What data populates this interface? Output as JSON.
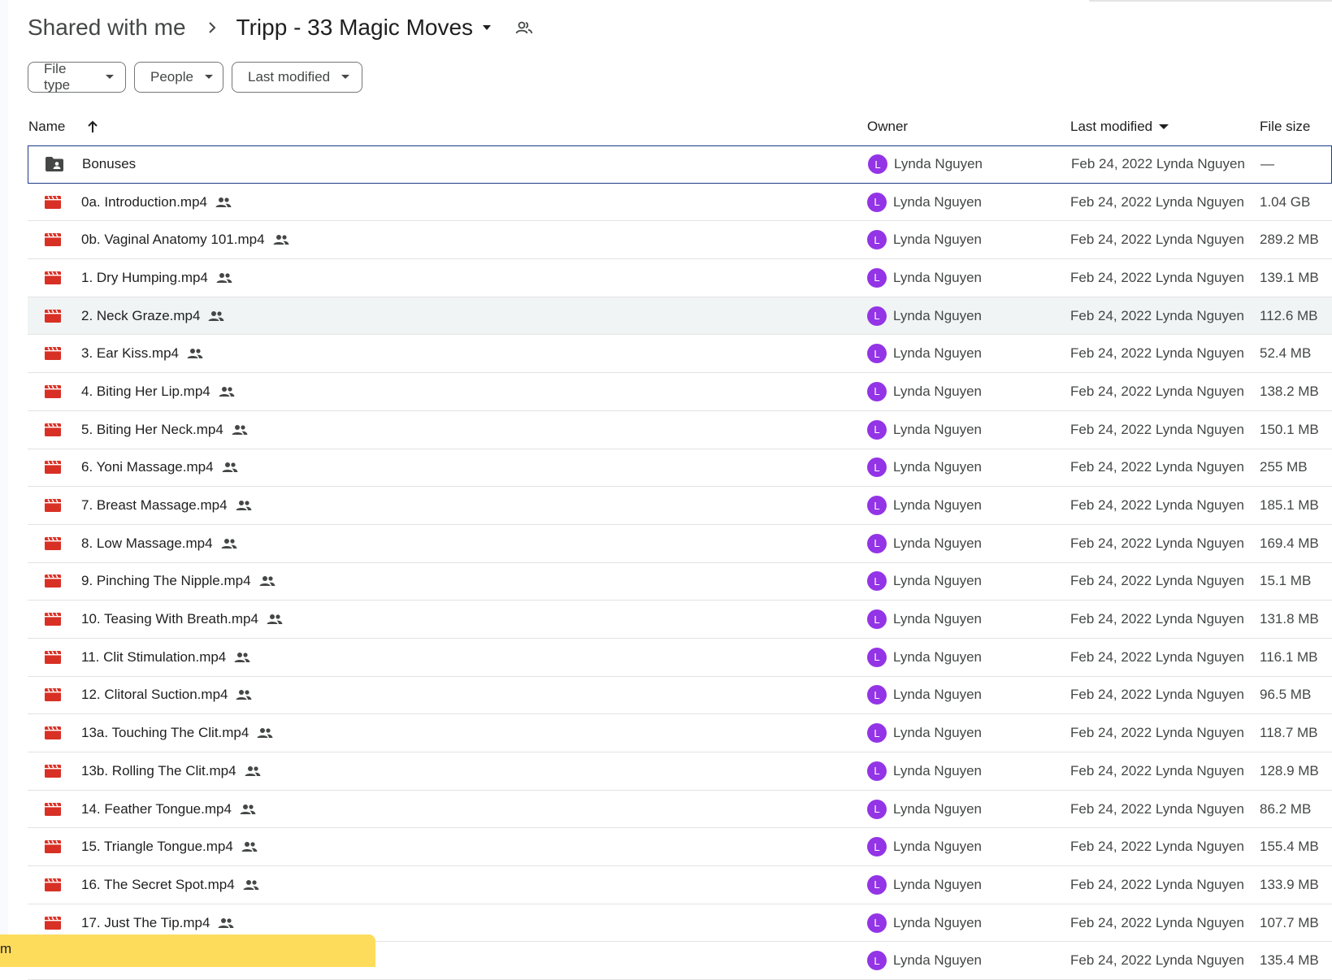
{
  "breadcrumb": {
    "root": "Shared with me",
    "current": "Tripp - 33 Magic Moves"
  },
  "filters": [
    {
      "label": "File type"
    },
    {
      "label": "People"
    },
    {
      "label": "Last modified"
    }
  ],
  "columns": {
    "name": "Name",
    "owner": "Owner",
    "last_modified": "Last modified",
    "file_size": "File size"
  },
  "rows": [
    {
      "name": "Bonuses",
      "type": "folder",
      "shared": false,
      "owner": "Lynda Nguyen",
      "owner_initial": "L",
      "modified": "Feb 24, 2022 Lynda Nguyen",
      "size": "—"
    },
    {
      "name": "0a. Introduction.mp4",
      "type": "video",
      "shared": true,
      "owner": "Lynda Nguyen",
      "owner_initial": "L",
      "modified": "Feb 24, 2022 Lynda Nguyen",
      "size": "1.04 GB"
    },
    {
      "name": "0b. Vaginal Anatomy 101.mp4",
      "type": "video",
      "shared": true,
      "owner": "Lynda Nguyen",
      "owner_initial": "L",
      "modified": "Feb 24, 2022 Lynda Nguyen",
      "size": "289.2 MB"
    },
    {
      "name": "1. Dry Humping.mp4",
      "type": "video",
      "shared": true,
      "owner": "Lynda Nguyen",
      "owner_initial": "L",
      "modified": "Feb 24, 2022 Lynda Nguyen",
      "size": "139.1 MB"
    },
    {
      "name": "2. Neck Graze.mp4",
      "type": "video",
      "shared": true,
      "owner": "Lynda Nguyen",
      "owner_initial": "L",
      "modified": "Feb 24, 2022 Lynda Nguyen",
      "size": "112.6 MB"
    },
    {
      "name": "3. Ear Kiss.mp4",
      "type": "video",
      "shared": true,
      "owner": "Lynda Nguyen",
      "owner_initial": "L",
      "modified": "Feb 24, 2022 Lynda Nguyen",
      "size": "52.4 MB"
    },
    {
      "name": "4. Biting Her Lip.mp4",
      "type": "video",
      "shared": true,
      "owner": "Lynda Nguyen",
      "owner_initial": "L",
      "modified": "Feb 24, 2022 Lynda Nguyen",
      "size": "138.2 MB"
    },
    {
      "name": "5. Biting Her Neck.mp4",
      "type": "video",
      "shared": true,
      "owner": "Lynda Nguyen",
      "owner_initial": "L",
      "modified": "Feb 24, 2022 Lynda Nguyen",
      "size": "150.1 MB"
    },
    {
      "name": "6. Yoni Massage.mp4",
      "type": "video",
      "shared": true,
      "owner": "Lynda Nguyen",
      "owner_initial": "L",
      "modified": "Feb 24, 2022 Lynda Nguyen",
      "size": "255 MB"
    },
    {
      "name": "7. Breast Massage.mp4",
      "type": "video",
      "shared": true,
      "owner": "Lynda Nguyen",
      "owner_initial": "L",
      "modified": "Feb 24, 2022 Lynda Nguyen",
      "size": "185.1 MB"
    },
    {
      "name": "8. Low Massage.mp4",
      "type": "video",
      "shared": true,
      "owner": "Lynda Nguyen",
      "owner_initial": "L",
      "modified": "Feb 24, 2022 Lynda Nguyen",
      "size": "169.4 MB"
    },
    {
      "name": "9. Pinching The Nipple.mp4",
      "type": "video",
      "shared": true,
      "owner": "Lynda Nguyen",
      "owner_initial": "L",
      "modified": "Feb 24, 2022 Lynda Nguyen",
      "size": "15.1 MB"
    },
    {
      "name": "10. Teasing With Breath.mp4",
      "type": "video",
      "shared": true,
      "owner": "Lynda Nguyen",
      "owner_initial": "L",
      "modified": "Feb 24, 2022 Lynda Nguyen",
      "size": "131.8 MB"
    },
    {
      "name": "11. Clit Stimulation.mp4",
      "type": "video",
      "shared": true,
      "owner": "Lynda Nguyen",
      "owner_initial": "L",
      "modified": "Feb 24, 2022 Lynda Nguyen",
      "size": "116.1 MB"
    },
    {
      "name": "12. Clitoral Suction.mp4",
      "type": "video",
      "shared": true,
      "owner": "Lynda Nguyen",
      "owner_initial": "L",
      "modified": "Feb 24, 2022 Lynda Nguyen",
      "size": "96.5 MB"
    },
    {
      "name": "13a. Touching The Clit.mp4",
      "type": "video",
      "shared": true,
      "owner": "Lynda Nguyen",
      "owner_initial": "L",
      "modified": "Feb 24, 2022 Lynda Nguyen",
      "size": "118.7 MB"
    },
    {
      "name": "13b. Rolling The Clit.mp4",
      "type": "video",
      "shared": true,
      "owner": "Lynda Nguyen",
      "owner_initial": "L",
      "modified": "Feb 24, 2022 Lynda Nguyen",
      "size": "128.9 MB"
    },
    {
      "name": "14. Feather Tongue.mp4",
      "type": "video",
      "shared": true,
      "owner": "Lynda Nguyen",
      "owner_initial": "L",
      "modified": "Feb 24, 2022 Lynda Nguyen",
      "size": "86.2 MB"
    },
    {
      "name": "15. Triangle Tongue.mp4",
      "type": "video",
      "shared": true,
      "owner": "Lynda Nguyen",
      "owner_initial": "L",
      "modified": "Feb 24, 2022 Lynda Nguyen",
      "size": "155.4 MB"
    },
    {
      "name": "16. The Secret Spot.mp4",
      "type": "video",
      "shared": true,
      "owner": "Lynda Nguyen",
      "owner_initial": "L",
      "modified": "Feb 24, 2022 Lynda Nguyen",
      "size": "133.9 MB"
    },
    {
      "name": "17. Just The Tip.mp4",
      "type": "video",
      "shared": true,
      "owner": "Lynda Nguyen",
      "owner_initial": "L",
      "modified": "Feb 24, 2022 Lynda Nguyen",
      "size": "107.7 MB"
    },
    {
      "name": "",
      "type": "none",
      "shared": false,
      "owner": "Lynda Nguyen",
      "owner_initial": "L",
      "modified": "Feb 24, 2022 Lynda Nguyen",
      "size": "135.4 MB"
    }
  ],
  "toast": {
    "text": "m"
  },
  "colors": {
    "accent_selected": "#1e3a8a",
    "avatar": "#9334e6",
    "video_icon": "#d93025",
    "folder_icon": "#444746",
    "toast_bg": "#fddc5c"
  }
}
